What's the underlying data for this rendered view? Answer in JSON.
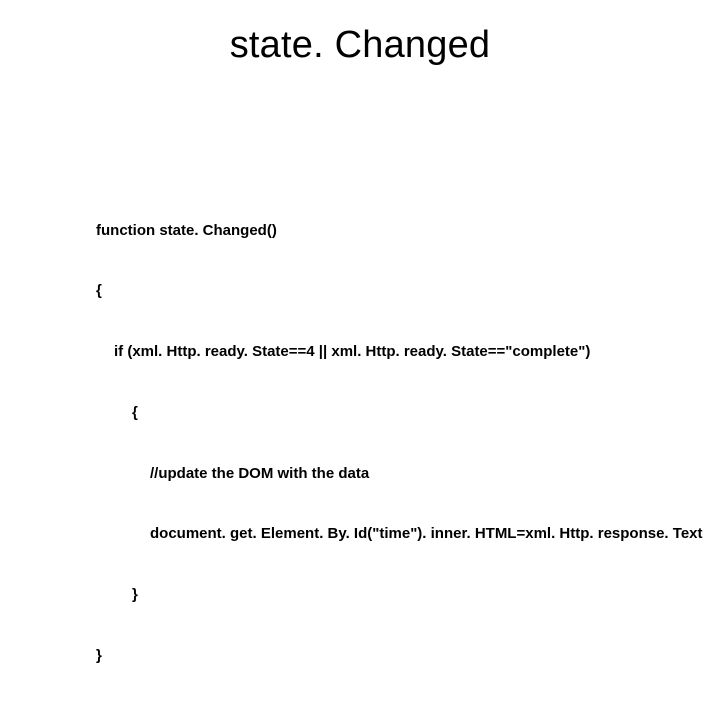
{
  "slide": {
    "title": "state. Changed",
    "code": {
      "l0": "function state. Changed()",
      "l1": "{",
      "l2": "if (xml. Http. ready. State==4 || xml. Http. ready. State==\"complete\")",
      "l3": "{",
      "l4": "//update the DOM with the data",
      "l5": "document. get. Element. By. Id(\"time\"). inner. HTML=xml. Http. response. Text",
      "l6": "}",
      "l7": "}"
    }
  }
}
